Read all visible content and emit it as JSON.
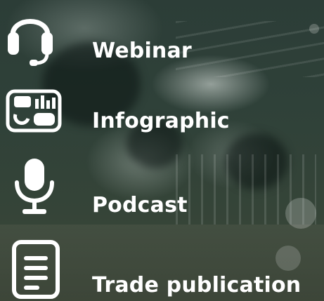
{
  "items": [
    {
      "label": "Webinar",
      "icon": "headset-icon"
    },
    {
      "label": "Infographic",
      "icon": "infographic-icon"
    },
    {
      "label": "Podcast",
      "icon": "microphone-icon"
    },
    {
      "label": "Trade publication",
      "icon": "document-icon"
    }
  ],
  "colors": {
    "text": "#ffffff",
    "icon": "#ffffff",
    "overlay": "#2c3d37"
  }
}
